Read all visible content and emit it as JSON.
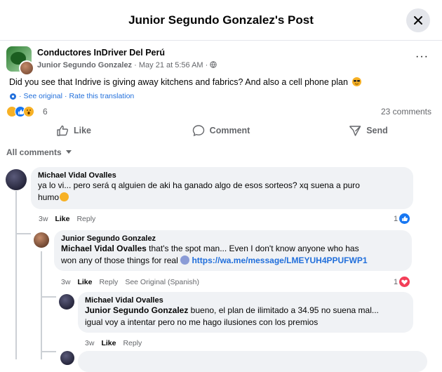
{
  "header": {
    "title": "Junior Segundo Gonzalez's Post",
    "close_icon": "close-icon"
  },
  "post": {
    "group_name": "Conductores InDriver Del Perú",
    "author": "Junior Segundo Gonzalez",
    "date": "May 21 at 5:56 AM",
    "separator": "·",
    "privacy_icon": "globe-icon",
    "more_label": "···",
    "text": "Did you see that Indrive is giving away kitchens and fabrics? And also a cell phone plan",
    "see_original": "See original",
    "rate_translation": "Rate this translation",
    "reaction_count": "6",
    "comments_count": "23 comments"
  },
  "actions": {
    "like": "Like",
    "comment": "Comment",
    "send": "Send"
  },
  "filter": {
    "label": "All comments"
  },
  "comments": [
    {
      "name": "Michael Vidal Ovalles",
      "text_line1": "ya lo vi... pero será q alguien de aki ha ganado algo de esos sorteos? xq suena a puro",
      "text_line2": "humo",
      "time": "3w",
      "like": "Like",
      "reply": "Reply",
      "reactions": "1"
    },
    {
      "name": "Junior Segundo Gonzalez",
      "mention": "Michael Vidal Ovalles",
      "text_line1": " that's the spot man... Even I don't know anyone who has",
      "text_line2": "won any of those things for real",
      "link": "https://wa.me/message/LMEYUH4PPUFWP1",
      "time": "3w",
      "like": "Like",
      "reply": "Reply",
      "see_original": "See Original (Spanish)",
      "reactions": "1"
    },
    {
      "name": "Michael Vidal Ovalles",
      "mention": "Junior Segundo Gonzalez",
      "text_line1": " bueno, el plan de ilimitado a 34.95 no suena mal...",
      "text_line2": "igual voy a intentar pero no me hago ilusiones con los premios",
      "time": "3w",
      "like": "Like",
      "reply": "Reply"
    }
  ],
  "colors": {
    "link": "#216fdb",
    "muted": "#65676b",
    "bubble": "#f0f2f5",
    "like_blue": "#1877f2",
    "love_red": "#f33e58"
  }
}
